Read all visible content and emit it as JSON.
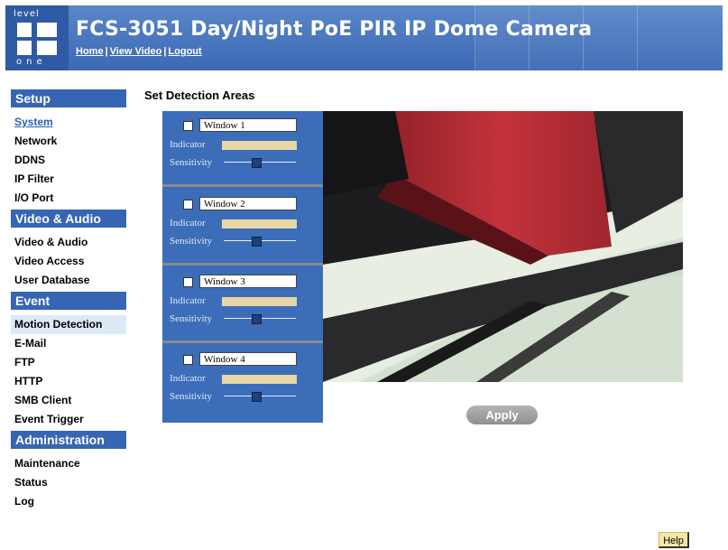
{
  "header": {
    "logo_top": "level",
    "logo_bottom": "one",
    "title": "FCS-3051 Day/Night PoE PIR IP Dome Camera",
    "nav": [
      "Home",
      "View Video",
      "Logout"
    ],
    "nav_separator": "|",
    "colors": {
      "band": "#3c69b4",
      "text": "#ffffff"
    }
  },
  "sidebar": {
    "sections": [
      {
        "title": "Setup",
        "items": [
          {
            "label": "System",
            "state": "link"
          },
          {
            "label": "Network"
          },
          {
            "label": "DDNS"
          },
          {
            "label": "IP Filter"
          },
          {
            "label": "I/O Port"
          }
        ]
      },
      {
        "title": "Video & Audio",
        "items": [
          {
            "label": "Video & Audio"
          },
          {
            "label": "Video Access"
          },
          {
            "label": "User Database"
          }
        ]
      },
      {
        "title": "Event",
        "items": [
          {
            "label": "Motion Detection",
            "state": "active"
          },
          {
            "label": "E-Mail"
          },
          {
            "label": "FTP"
          },
          {
            "label": "HTTP"
          },
          {
            "label": "SMB Client"
          },
          {
            "label": "Event Trigger"
          }
        ]
      },
      {
        "title": "Administration",
        "items": [
          {
            "label": "Maintenance"
          },
          {
            "label": "Status"
          },
          {
            "label": "Log"
          }
        ]
      }
    ]
  },
  "main": {
    "title": "Set Detection Areas",
    "windows": [
      {
        "name": "Window 1",
        "checked": false,
        "indicator_label": "Indicator",
        "sensitivity_label": "Sensitivity",
        "sensitivity": 0.45
      },
      {
        "name": "Window 2",
        "checked": false,
        "indicator_label": "Indicator",
        "sensitivity_label": "Sensitivity",
        "sensitivity": 0.45
      },
      {
        "name": "Window 3",
        "checked": false,
        "indicator_label": "Indicator",
        "sensitivity_label": "Sensitivity",
        "sensitivity": 0.45
      },
      {
        "name": "Window 4",
        "checked": false,
        "indicator_label": "Indicator",
        "sensitivity_label": "Sensitivity",
        "sensitivity": 0.45
      }
    ],
    "apply_label": "Apply",
    "help_label": "Help"
  }
}
